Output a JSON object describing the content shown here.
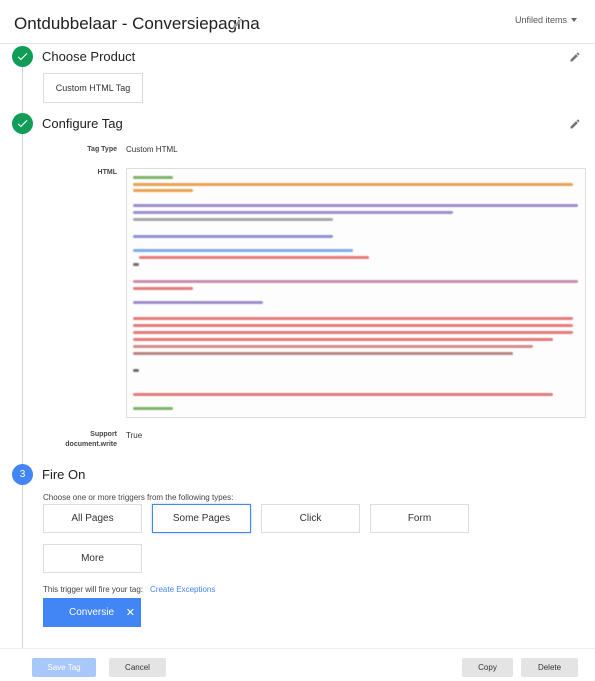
{
  "header": {
    "title": "Ontdubbelaar - Conversiepagina",
    "folder": "Unfiled items"
  },
  "steps": [
    {
      "number": "✓",
      "title": "Choose Product",
      "state": "done"
    },
    {
      "number": "✓",
      "title": "Configure Tag",
      "state": "done"
    },
    {
      "number": "3",
      "title": "Fire On",
      "state": "active"
    }
  ],
  "product": {
    "selected": "Custom HTML Tag"
  },
  "configure": {
    "tag_type_label": "Tag Type",
    "tag_type_value": "Custom HTML",
    "html_label": "HTML",
    "support_label_1": "Support",
    "support_label_2": "document.write",
    "support_value": "True"
  },
  "fire_on": {
    "intro": "Choose one or more triggers from the following types:",
    "trigger_types": [
      "All Pages",
      "Some Pages",
      "Click",
      "Form",
      "More"
    ],
    "selected_type": "Some Pages",
    "fires_label": "This trigger will fire your tag:",
    "exceptions_link": "Create Exceptions",
    "trigger_chip": "Conversie"
  },
  "footer": {
    "save": "Save Tag",
    "cancel": "Cancel",
    "copy": "Copy",
    "delete": "Delete"
  },
  "colors": {
    "done_green": "#0f9d58",
    "active_blue": "#4285f4",
    "rail_grey": "#d4d4d4"
  }
}
